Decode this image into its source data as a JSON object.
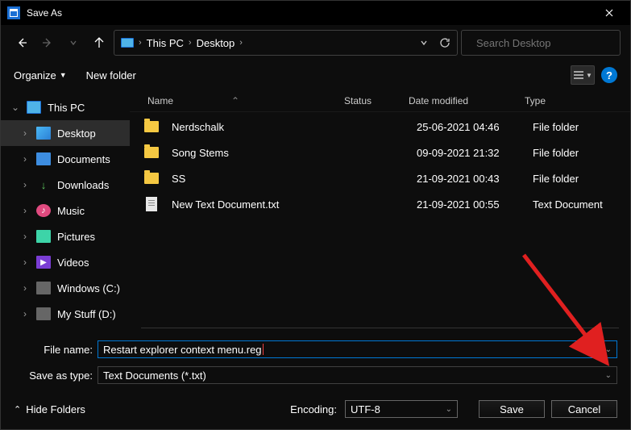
{
  "title": "Save As",
  "breadcrumb": {
    "root": "This PC",
    "leaf": "Desktop"
  },
  "search": {
    "placeholder": "Search Desktop"
  },
  "toolbar": {
    "organize": "Organize",
    "new_folder": "New folder"
  },
  "sidebar": {
    "root": "This PC",
    "items": [
      {
        "label": "Desktop"
      },
      {
        "label": "Documents"
      },
      {
        "label": "Downloads"
      },
      {
        "label": "Music"
      },
      {
        "label": "Pictures"
      },
      {
        "label": "Videos"
      },
      {
        "label": "Windows (C:)"
      },
      {
        "label": "My Stuff (D:)"
      }
    ]
  },
  "columns": {
    "name": "Name",
    "status": "Status",
    "date": "Date modified",
    "type": "Type"
  },
  "files": [
    {
      "name": "Nerdschalk",
      "date": "25-06-2021 04:46",
      "type": "File folder",
      "kind": "folder"
    },
    {
      "name": "Song Stems",
      "date": "09-09-2021 21:32",
      "type": "File folder",
      "kind": "folder"
    },
    {
      "name": "SS",
      "date": "21-09-2021 00:43",
      "type": "File folder",
      "kind": "folder"
    },
    {
      "name": "New Text Document.txt",
      "date": "21-09-2021 00:55",
      "type": "Text Document",
      "kind": "txt"
    }
  ],
  "inputs": {
    "filename_label": "File name:",
    "filename_value": "Restart explorer context menu.reg",
    "type_label": "Save as type:",
    "type_value": "Text Documents (*.txt)"
  },
  "footer": {
    "hide_folders": "Hide Folders",
    "encoding_label": "Encoding:",
    "encoding_value": "UTF-8",
    "save": "Save",
    "cancel": "Cancel"
  },
  "help": "?"
}
